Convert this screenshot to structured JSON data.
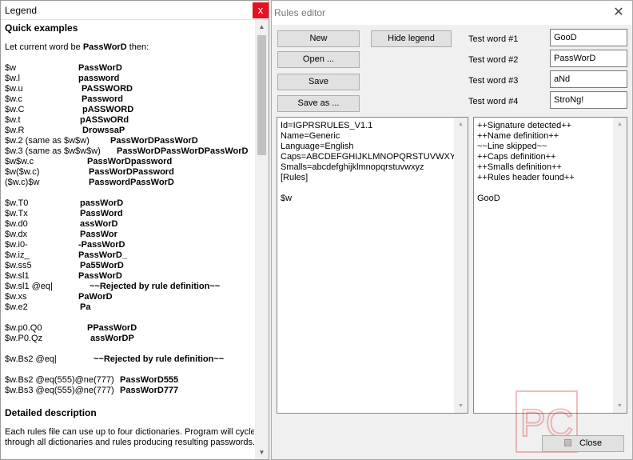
{
  "legend": {
    "title": "Legend",
    "close_glyph": "x",
    "quick_heading": "Quick examples",
    "intro_pre": "Let current word be ",
    "intro_word": "PassWorD",
    "intro_post": " then:",
    "examples_1": [
      {
        "rule": "$w",
        "result": "PassWorD"
      },
      {
        "rule": "$w.l",
        "result": "password"
      },
      {
        "rule": "$w.u",
        "result": "PASSWORD"
      },
      {
        "rule": "$w.c",
        "result": "Password"
      },
      {
        "rule": "$w.C",
        "result": "pASSWORD"
      },
      {
        "rule": "$w.t",
        "result": "pASSwORd"
      },
      {
        "rule": "$w.R",
        "result": "DrowssaP"
      },
      {
        "rule": "$w.2 (same as $w$w)",
        "result": "PassWorDPassWorD"
      },
      {
        "rule": "$w.3 (same as $w$w$w)",
        "result": "PassWorDPassWorDPassWorD"
      },
      {
        "rule": "$w$w.c",
        "result": "PassWorDpassword"
      },
      {
        "rule": "$w($w.c)",
        "result": "PassWorDPassword"
      },
      {
        "rule": "($w.c)$w",
        "result": "PasswordPassWorD"
      }
    ],
    "examples_2": [
      {
        "rule": "$w.T0",
        "result": "passWorD"
      },
      {
        "rule": "$w.Tx",
        "result": "PassWord"
      },
      {
        "rule": "$w.d0",
        "result": "assWorD"
      },
      {
        "rule": "$w.dx",
        "result": "PassWor"
      },
      {
        "rule": "$w.i0-",
        "result": "-PassWorD"
      },
      {
        "rule": "$w.iz_",
        "result": "PassWorD_"
      },
      {
        "rule": "$w.ss5",
        "result": "Pa55WorD"
      },
      {
        "rule": "$w.sl1",
        "result": "PassWorD"
      },
      {
        "rule": "$w.sl1 @eq|",
        "result": "~~Rejected by rule definition~~"
      },
      {
        "rule": "$w.xs",
        "result": "PaWorD"
      },
      {
        "rule": "$w.e2",
        "result": "Pa"
      }
    ],
    "examples_3": [
      {
        "rule": "$w.p0.Q0",
        "result": "PPassWorD"
      },
      {
        "rule": "$w.P0.Qz",
        "result": "assWorDP"
      }
    ],
    "examples_4": [
      {
        "rule": "$w.Bs2 @eq|",
        "result": "~~Rejected by rule definition~~"
      }
    ],
    "examples_5": [
      {
        "rule": "$w.Bs2 @eq(555)@ne(777)",
        "result": "PassWorD555"
      },
      {
        "rule": "$w.Bs3 @eq(555)@ne(777)",
        "result": "PassWorD777"
      }
    ],
    "detail_heading": "Detailed description",
    "detail_lines": [
      "Each rules file can use up to four dictionaries. Program will cycle",
      "through all dictionaries and rules producing resulting passwords."
    ]
  },
  "editor": {
    "title": "Rules editor",
    "close_glyph": "✕",
    "buttons": {
      "new": "New",
      "open": "Open ...",
      "save": "Save",
      "save_as": "Save as ...",
      "hide_legend": "Hide legend",
      "close": "Close"
    },
    "test_words": [
      {
        "label": "Test word #1",
        "value": "GooD"
      },
      {
        "label": "Test word #2",
        "value": "PassWorD"
      },
      {
        "label": "Test word #3",
        "value": "aNd"
      },
      {
        "label": "Test word #4",
        "value": "StroNg!"
      }
    ],
    "rules_text": [
      "Id=IGPRSRULES_V1.1",
      "Name=Generic",
      "Language=English",
      "Caps=ABCDEFGHIJKLMNOPQRSTUVWXYZ",
      "Smalls=abcdefghijklmnopqrstuvwxyz",
      "[Rules]",
      "",
      "$w"
    ],
    "output_text": [
      "++Signature detected++",
      "++Name definition++",
      "~~Line skipped~~",
      "++Caps definition++",
      "++Smalls definition++",
      "++Rules header found++",
      "",
      "GooD"
    ]
  },
  "watermark_text": "PC"
}
